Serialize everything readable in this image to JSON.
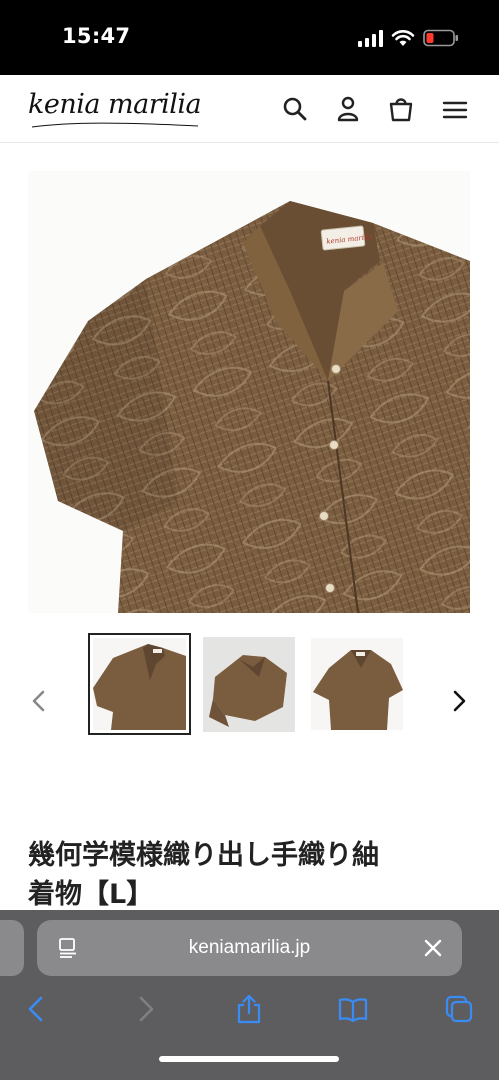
{
  "status_bar": {
    "time": "15:47",
    "signal_icon": "cellular-signal-icon",
    "wifi_icon": "wifi-icon",
    "battery_icon": "battery-low-icon",
    "battery_color": "#ff3b30"
  },
  "header": {
    "logo_text": "kenia marilia",
    "icons": [
      "search-icon",
      "account-icon",
      "cart-icon",
      "menu-icon"
    ]
  },
  "gallery": {
    "main_image": "brown-patterned-shirt-photo",
    "label_tag": "kenia marilia",
    "thumbnails": [
      {
        "name": "thumbnail-1",
        "active": true
      },
      {
        "name": "thumbnail-2",
        "active": false
      },
      {
        "name": "thumbnail-3",
        "active": false
      }
    ],
    "prev_icon": "chevron-left-icon",
    "next_icon": "chevron-right-icon"
  },
  "product": {
    "title_line1": "幾何学模様織り出し手織り紬",
    "title_line2": "着物【L】"
  },
  "browser": {
    "url": "keniamarilia.jp",
    "reader_icon": "reader-mode-icon",
    "clear_icon": "close-icon",
    "toolbar": [
      "back-icon",
      "forward-icon",
      "share-icon",
      "bookmarks-icon",
      "tabs-icon"
    ],
    "accent": "#3a8cf5"
  }
}
